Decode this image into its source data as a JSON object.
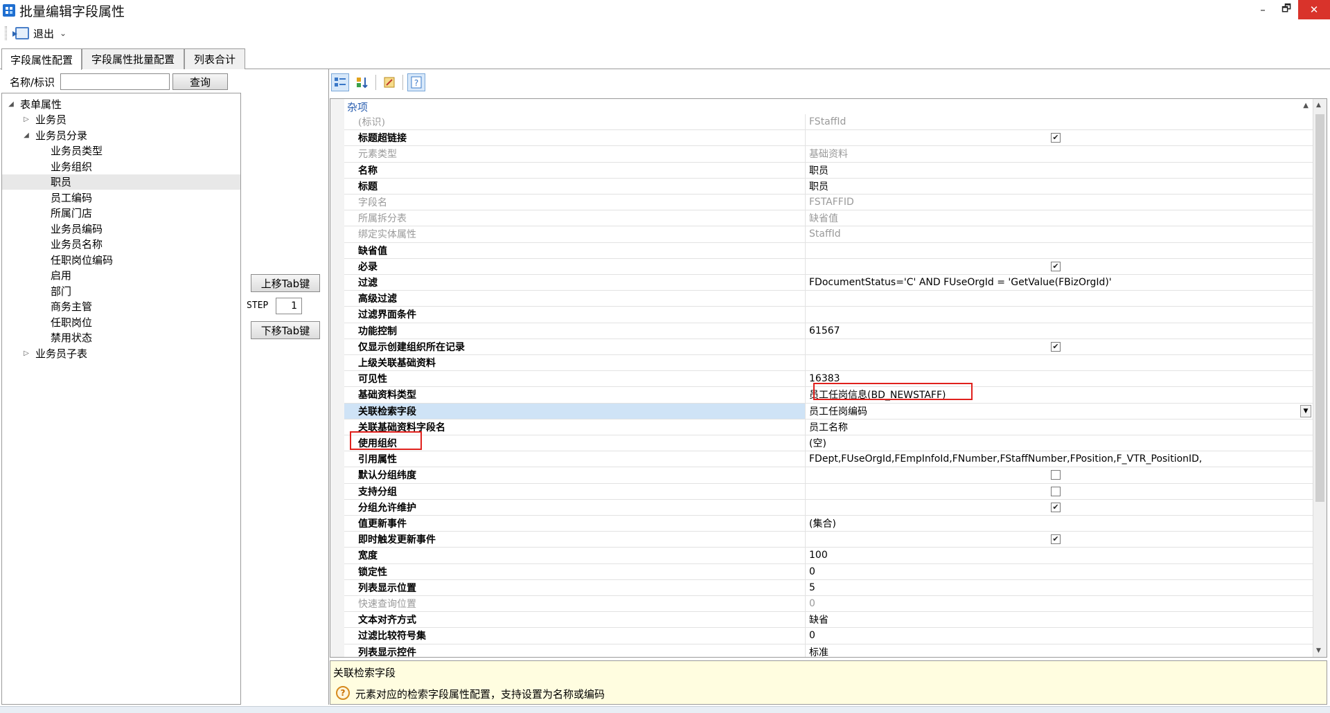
{
  "window": {
    "title": "批量编辑字段属性",
    "minimize": "–",
    "restore": "🗗",
    "close": "✕"
  },
  "toolbar": {
    "exit_label": "退出",
    "exit_caret": "⌄"
  },
  "tabs": [
    {
      "label": "字段属性配置",
      "active": true
    },
    {
      "label": "字段属性批量配置",
      "active": false
    },
    {
      "label": "列表合计",
      "active": false
    }
  ],
  "search": {
    "label": "名称/标识",
    "value": "",
    "button": "查询"
  },
  "tree": [
    {
      "label": "表单属性",
      "arrow": "◢",
      "level": 0
    },
    {
      "label": "业务员",
      "arrow": "▷",
      "level": 1
    },
    {
      "label": "业务员分录",
      "arrow": "◢",
      "level": 1
    },
    {
      "label": "业务员类型",
      "arrow": "",
      "level": 2
    },
    {
      "label": "业务组织",
      "arrow": "",
      "level": 2
    },
    {
      "label": "职员",
      "arrow": "",
      "level": 2,
      "selected": true
    },
    {
      "label": "员工编码",
      "arrow": "",
      "level": 2
    },
    {
      "label": "所属门店",
      "arrow": "",
      "level": 2
    },
    {
      "label": "业务员编码",
      "arrow": "",
      "level": 2
    },
    {
      "label": "业务员名称",
      "arrow": "",
      "level": 2
    },
    {
      "label": "任职岗位编码",
      "arrow": "",
      "level": 2
    },
    {
      "label": "启用",
      "arrow": "",
      "level": 2
    },
    {
      "label": "部门",
      "arrow": "",
      "level": 2
    },
    {
      "label": "商务主管",
      "arrow": "",
      "level": 2
    },
    {
      "label": "任职岗位",
      "arrow": "",
      "level": 2
    },
    {
      "label": "禁用状态",
      "arrow": "",
      "level": 2
    },
    {
      "label": "业务员子表",
      "arrow": "▷",
      "level": 1
    }
  ],
  "middle": {
    "move_up": "上移Tab键",
    "step_label": "STEP",
    "step_value": "1",
    "move_down": "下移Tab键"
  },
  "grid": {
    "category": "杂项",
    "category_toggle": "▲",
    "rows": [
      {
        "name": "(标识)",
        "value": "FStaffId",
        "disabled": true
      },
      {
        "name": "标题超链接",
        "value": "",
        "checkbox": "✔"
      },
      {
        "name": "元素类型",
        "value": "基础资料",
        "disabled": true
      },
      {
        "name": "名称",
        "value": "职员"
      },
      {
        "name": "标题",
        "value": "职员"
      },
      {
        "name": "字段名",
        "value": "FSTAFFID",
        "disabled": true
      },
      {
        "name": "所属拆分表",
        "value": "缺省值",
        "disabled": true
      },
      {
        "name": "绑定实体属性",
        "value": "StaffId",
        "disabled": true
      },
      {
        "name": "缺省值",
        "value": ""
      },
      {
        "name": "必录",
        "value": "",
        "checkbox": "✔"
      },
      {
        "name": "过滤",
        "value": "FDocumentStatus='C' AND FUseOrgId = 'GetValue(FBizOrgId)'"
      },
      {
        "name": "高级过滤",
        "value": ""
      },
      {
        "name": "过滤界面条件",
        "value": ""
      },
      {
        "name": "功能控制",
        "value": "61567"
      },
      {
        "name": "仅显示创建组织所在记录",
        "value": "",
        "checkbox": "✔"
      },
      {
        "name": "上级关联基础资料",
        "value": ""
      },
      {
        "name": "可见性",
        "value": "16383"
      },
      {
        "name": "基础资料类型",
        "value": "员工任岗信息(BD_NEWSTAFF)"
      },
      {
        "name": "关联检索字段",
        "value": "员工任岗编码",
        "selected": true,
        "dropdown": "▼"
      },
      {
        "name": "关联基础资料字段名",
        "value": "员工名称"
      },
      {
        "name": "使用组织",
        "value": "(空)"
      },
      {
        "name": "引用属性",
        "value": "FDept,FUseOrgId,FEmpInfoId,FNumber,FStaffNumber,FPosition,F_VTR_PositionID,"
      },
      {
        "name": "默认分组纬度",
        "value": "",
        "checkbox": ""
      },
      {
        "name": "支持分组",
        "value": "",
        "checkbox": ""
      },
      {
        "name": "分组允许维护",
        "value": "",
        "checkbox": "✔"
      },
      {
        "name": "值更新事件",
        "value": "(集合)"
      },
      {
        "name": "即时触发更新事件",
        "value": "",
        "checkbox": "✔"
      },
      {
        "name": "宽度",
        "value": "100"
      },
      {
        "name": "锁定性",
        "value": "0"
      },
      {
        "name": "列表显示位置",
        "value": "5"
      },
      {
        "name": "快速查询位置",
        "value": "0",
        "disabled": true
      },
      {
        "name": "文本对齐方式",
        "value": "缺省"
      },
      {
        "name": "过滤比较符号集",
        "value": "0"
      },
      {
        "name": "列表显示控件",
        "value": "标准"
      }
    ]
  },
  "description": {
    "title": "关联检索字段",
    "icon": "?",
    "text": "元素对应的检索字段属性配置，支持设置为名称或编码"
  },
  "colors": {
    "accent": "#2b5fb0",
    "highlight": "#e0201c",
    "selected_row": "#cfe3f6",
    "desc_bg": "#fffde0"
  }
}
